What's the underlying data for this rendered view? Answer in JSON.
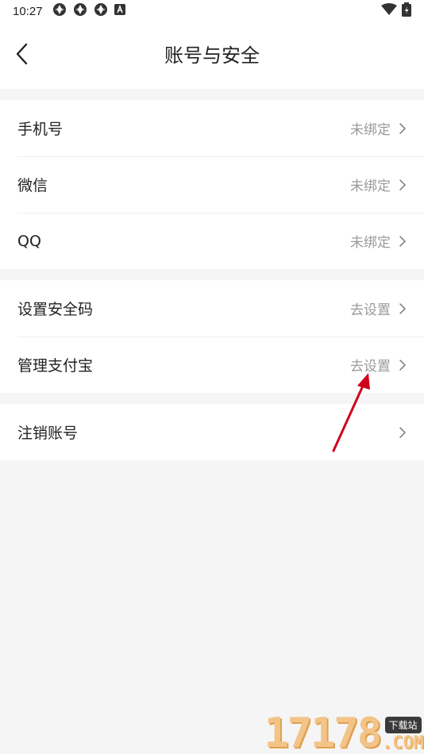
{
  "status_bar": {
    "time": "10:27",
    "notification_icons": [
      "sync-icon",
      "sync-icon",
      "sync-icon",
      "a-badge-icon"
    ],
    "right_icons": [
      "wifi-icon",
      "battery-icon"
    ]
  },
  "header": {
    "title": "账号与安全",
    "back_icon": "chevron-left-icon"
  },
  "groups": [
    {
      "items": [
        {
          "label": "手机号",
          "value": "未绑定"
        },
        {
          "label": "微信",
          "value": "未绑定"
        },
        {
          "label": "QQ",
          "value": "未绑定"
        }
      ]
    },
    {
      "items": [
        {
          "label": "设置安全码",
          "value": "去设置"
        },
        {
          "label": "管理支付宝",
          "value": "去设置"
        }
      ]
    },
    {
      "items": [
        {
          "label": "注销账号",
          "value": ""
        }
      ]
    }
  ],
  "annotation": {
    "color": "#d0021b"
  },
  "watermark": {
    "digits": "17178",
    "badge": "下载站",
    "suffix": ".COM"
  },
  "colors": {
    "background": "#f5f5f5",
    "card": "#ffffff",
    "text": "#222222",
    "secondary_text": "#9a9a9a"
  }
}
